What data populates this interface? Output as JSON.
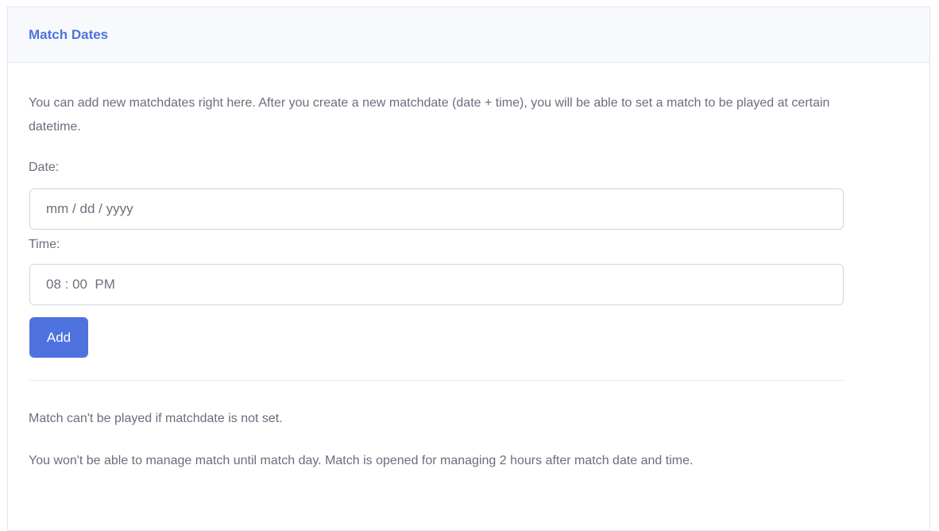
{
  "card": {
    "title": "Match Dates",
    "intro": "You can add new matchdates right here. After you create a new matchdate (date + time), you will be able to set a match to be played at certain datetime."
  },
  "form": {
    "date_label": "Date:",
    "date_value": "mm / dd / yyyy",
    "time_label": "Time:",
    "time_value": "08 : 00  PM",
    "add_label": "Add"
  },
  "notes": {
    "note_1": "Match can't be played if matchdate is not set.",
    "note_2": "You won't be able to manage match until match day. Match is opened for managing 2 hours after match date and time."
  },
  "colors": {
    "accent": "#4e73df",
    "header_bg": "#f8f9fc",
    "text": "#6b6d7c",
    "border": "#e3e6f0"
  }
}
